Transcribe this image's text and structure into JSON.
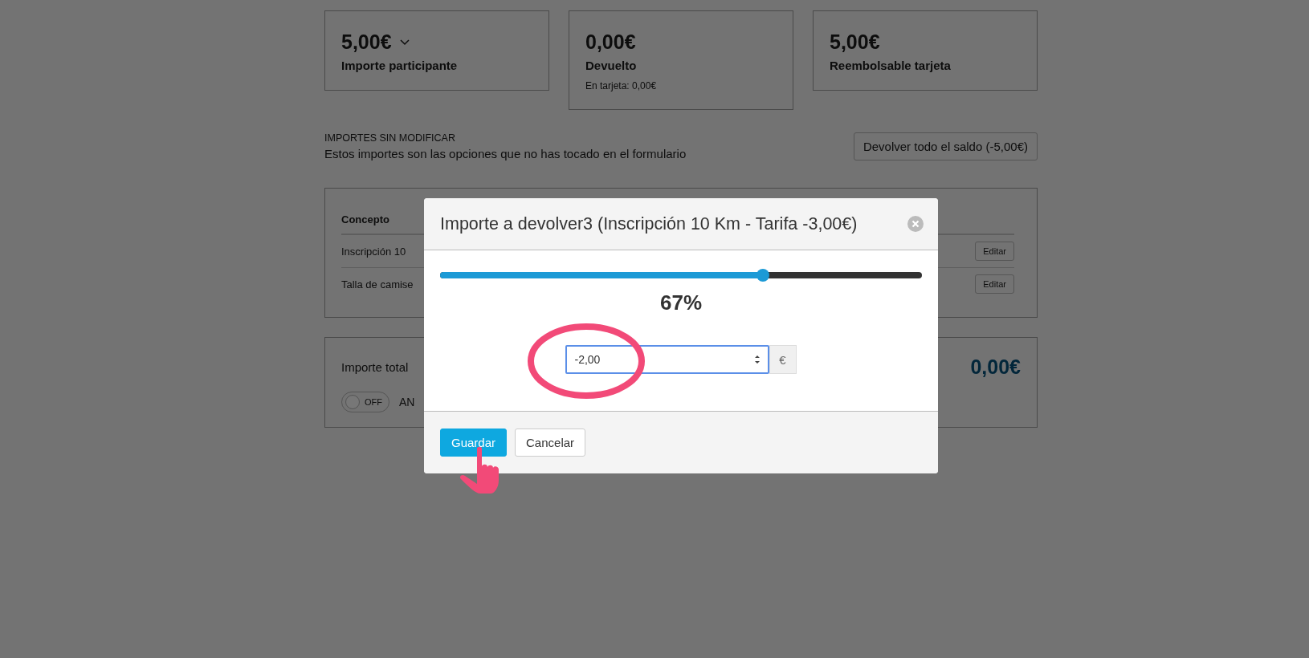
{
  "cards": [
    {
      "amount": "5,00€",
      "dropdown": true,
      "label": "Importe participante"
    },
    {
      "amount": "0,00€",
      "dropdown": false,
      "label": "Devuelto",
      "note": "En tarjeta: 0,00€"
    },
    {
      "amount": "5,00€",
      "dropdown": false,
      "label": "Reembolsable tarjeta"
    }
  ],
  "unmodified": {
    "heading": "IMPORTES SIN MODIFICAR",
    "description": "Estos importes son las opciones que no has tocado en el formulario",
    "action": "Devolver todo el saldo (-5,00€)"
  },
  "table": {
    "columns": [
      "Concepto"
    ],
    "rows": [
      {
        "concept": "Inscripción 10",
        "action": "Editar"
      },
      {
        "concept": "Talla de camise",
        "action": "Editar"
      }
    ]
  },
  "total": {
    "label": "Importe total",
    "amount": "0,00€",
    "toggle": {
      "text": "OFF",
      "on": false
    },
    "toggle_label": "AN"
  },
  "modal": {
    "title": "Importe a devolver3 (Inscripción 10 Km - Tarifa -3,00€)",
    "slider": {
      "level": 0.67
    },
    "percent": "67%",
    "input": {
      "value": "-2,00"
    },
    "addon": "€",
    "buttons": [
      {
        "label": "Guardar",
        "kind": "primary"
      },
      {
        "label": "Cancelar",
        "kind": "default"
      }
    ]
  }
}
